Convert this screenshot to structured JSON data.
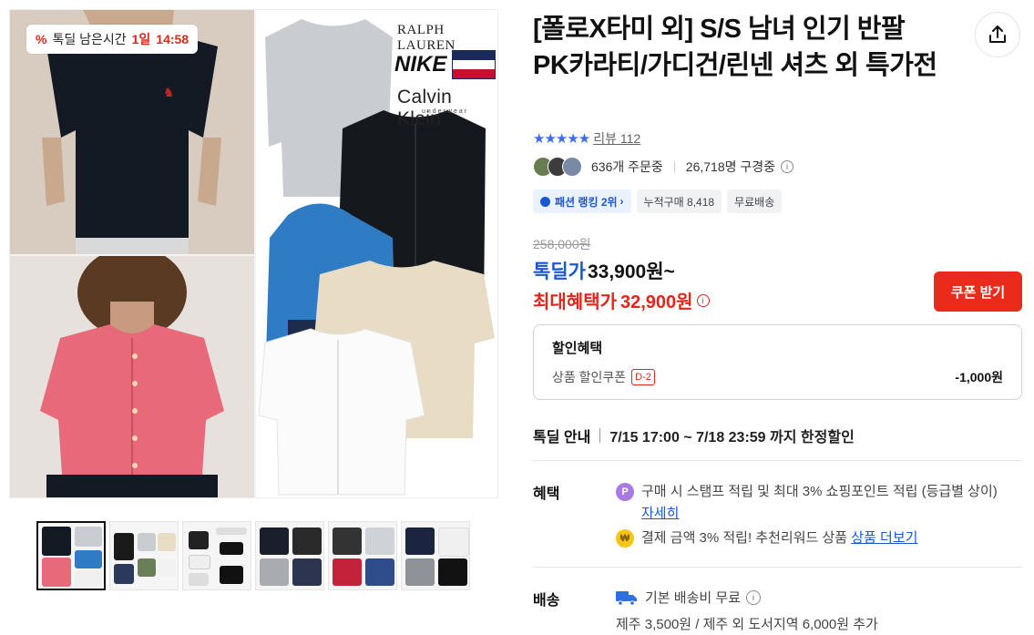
{
  "gallery": {
    "timer_prefix": "톡딜 남은시간",
    "timer_day": "1일",
    "timer_time": "14:58",
    "brands": {
      "ralph": "RALPH LAUREN",
      "nike": "NIKE",
      "ck": "Calvin Klein",
      "ck_sub": "underwear"
    },
    "thumbnail_count": 6
  },
  "product": {
    "title": "[폴로X타미 외] S/S 남녀 인기 반팔 PK카라티/가디건/린넨 셔츠 외 특가전",
    "review_label": "리뷰 112",
    "orders": "636개 주문중",
    "viewers": "26,718명 구경중",
    "tags": [
      "패션 랭킹 2위",
      "누적구매 8,418",
      "무료배송"
    ],
    "original_price": "258,000원",
    "deal_label": "톡딜가",
    "deal_price": "33,900원~",
    "max_label": "최대혜택가",
    "max_price": "32,900원",
    "coupon_button": "쿠폰 받기"
  },
  "benefit_box": {
    "title": "할인혜택",
    "line_label": "상품 할인쿠폰",
    "dday": "D-2",
    "amount": "-1,000원"
  },
  "deal_guide": {
    "label": "톡딜 안내",
    "text": "7/15 17:00 ~ 7/18 23:59 까지 한정할인"
  },
  "perks": {
    "label": "혜택",
    "point_text": "구매 시 스탬프 적립 및 최대 3% 쇼핑포인트 적립 (등급별 상이) ",
    "point_link": "자세히",
    "pay_text": "결제 금액 3% 적립! 추천리워드 상품 ",
    "pay_link": "상품 더보기"
  },
  "shipping": {
    "label": "배송",
    "base": "기본 배송비 무료",
    "extra": "제주 3,500원 / 제주 외 도서지역 6,000원 추가"
  },
  "colors": {
    "accent_blue": "#1b56d3",
    "accent_red": "#e3261b",
    "coupon_red": "#ea2a1b"
  }
}
